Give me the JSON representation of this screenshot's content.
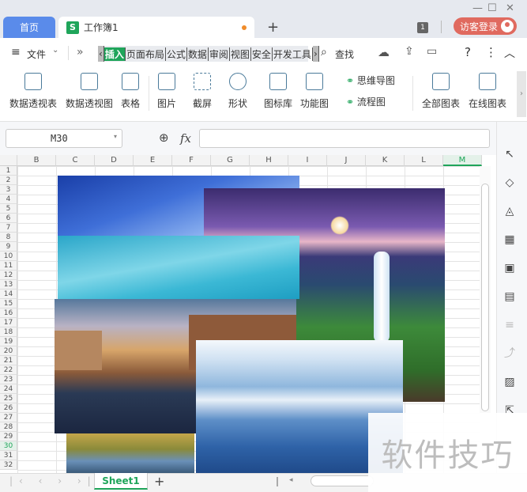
{
  "titlebar": {
    "home_tab": "首页",
    "doc_icon": "S",
    "doc_tab": "工作簿1",
    "new_tab": "+",
    "window_count": "1",
    "login": "访客登录"
  },
  "menubar": {
    "file": "文件",
    "more": "»",
    "tabs": [
      "插入",
      "页面布局",
      "公式",
      "数据",
      "审阅",
      "视图",
      "安全",
      "开发工具"
    ],
    "active_tab": "插入",
    "search": "查找",
    "help": "?",
    "kebab": "⋮",
    "collapse": "︿"
  },
  "ribbon": {
    "buttons": [
      "数据透视表",
      "数据透视图",
      "表格",
      "图片",
      "截屏",
      "形状",
      "图标库",
      "功能图",
      "全部图表",
      "在线图表"
    ],
    "small": [
      "思维导图",
      "流程图"
    ]
  },
  "formula": {
    "cell_ref": "M30",
    "fx": "fx"
  },
  "grid": {
    "columns": [
      "B",
      "C",
      "D",
      "E",
      "F",
      "G",
      "H",
      "I",
      "J",
      "K",
      "L",
      "M"
    ],
    "rows": [
      "1",
      "2",
      "3",
      "4",
      "5",
      "6",
      "7",
      "8",
      "9",
      "10",
      "11",
      "12",
      "13",
      "14",
      "15",
      "16",
      "17",
      "18",
      "19",
      "20",
      "21",
      "22",
      "23",
      "24",
      "25",
      "26",
      "27",
      "28",
      "29",
      "30",
      "31",
      "32"
    ],
    "selected_column": "M",
    "selected_row": "30"
  },
  "sheet": {
    "tab": "Sheet1",
    "add": "+"
  },
  "watermark": "软件技巧",
  "icons": [
    "cloud-icon",
    "share-icon",
    "gear-icon",
    "cursor-icon",
    "shapes-icon",
    "fill-icon",
    "table-icon",
    "grid4-icon",
    "chart-icon",
    "image-icon",
    "crop-icon"
  ]
}
